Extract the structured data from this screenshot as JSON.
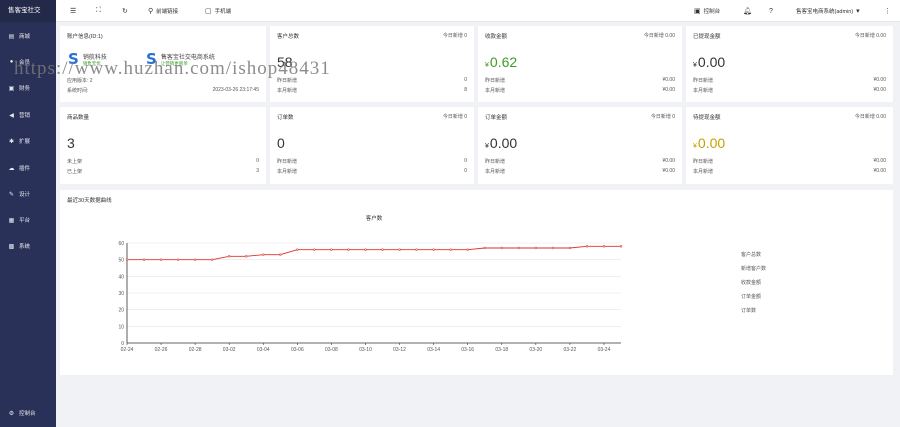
{
  "sidebar": {
    "brand": "售客宝社交",
    "items": [
      {
        "label": "商城",
        "icon": "shop-icon"
      },
      {
        "label": "会员",
        "icon": "member-icon"
      },
      {
        "label": "财务",
        "icon": "wallet-icon"
      },
      {
        "label": "营销",
        "icon": "megaphone-icon"
      },
      {
        "label": "扩展",
        "icon": "puzzle-icon"
      },
      {
        "label": "插件",
        "icon": "cloud-icon"
      },
      {
        "label": "设计",
        "icon": "design-icon"
      },
      {
        "label": "平台",
        "icon": "grid-icon"
      },
      {
        "label": "系统",
        "icon": "gear-icon"
      }
    ],
    "bottom": {
      "label": "控制台",
      "icon": "settings-icon"
    }
  },
  "topbar": {
    "menu_icon": "menu-icon",
    "fullscreen_icon": "fullscreen-icon",
    "refresh_icon": "refresh-icon",
    "link_label": "前端链接",
    "mobile_label": "手机端",
    "dashboard_label": "控制台",
    "user_label": "售客宝电商系统(admin)"
  },
  "cards": {
    "account": {
      "title": "账户信息(ID:1)",
      "logo1_title": "销航科技",
      "logo1_sub": "销售无忧",
      "logo2_title": "售客宝社交电商系统",
      "logo2_sub": "让营销更简单",
      "row1_label": "应用版本: 2",
      "row2_label": "系统时间:",
      "row2_value": "2023-03-26 23:17:45"
    },
    "customers": {
      "title": "客户总数",
      "today": "今日新增 0",
      "value": "58",
      "row1_label": "昨日新增",
      "row1_value": "0",
      "row2_label": "本月新增",
      "row2_value": "8"
    },
    "revenue": {
      "title": "收款金额",
      "today": "今日新增 0.00",
      "currency": "¥",
      "value": "0.62",
      "row1_label": "昨日新增",
      "row1_value": "¥0.00",
      "row2_label": "本月新增",
      "row2_value": "¥0.00"
    },
    "withdrawn": {
      "title": "已提现金额",
      "today": "今日新增 0.00",
      "currency": "¥",
      "value": "0.00",
      "row1_label": "昨日新增",
      "row1_value": "¥0.00",
      "row2_label": "本月新增",
      "row2_value": "¥0.00"
    },
    "products": {
      "title": "商品数量",
      "value": "3",
      "row1_label": "未上架",
      "row1_value": "0",
      "row2_label": "已上架",
      "row2_value": "3"
    },
    "orders": {
      "title": "订单数",
      "today": "今日新增 0",
      "value": "0",
      "row1_label": "昨日新增",
      "row1_value": "0",
      "row2_label": "本月新增",
      "row2_value": "0"
    },
    "order_amount": {
      "title": "订单金额",
      "today": "今日新增 0",
      "currency": "¥",
      "value": "0.00",
      "row1_label": "昨日新增",
      "row1_value": "¥0.00",
      "row2_label": "本月新增",
      "row2_value": "¥0.00"
    },
    "pending": {
      "title": "待提现金额",
      "today": "今日新增 0.00",
      "currency": "¥",
      "value": "0.00",
      "row1_label": "昨日新增",
      "row1_value": "¥0.00",
      "row2_label": "本月新增",
      "row2_value": "¥0.00"
    }
  },
  "chart_section": {
    "title": "最近30天数据曲线"
  },
  "watermark": "https://www.huzhan.com/ishop48431",
  "colors": {
    "sidebar": "#2a3158",
    "accent_green": "#3e9b28",
    "accent_gold": "#c7a000",
    "series_red": "#d9342b"
  },
  "chart_data": {
    "type": "line",
    "title": "客户数",
    "x": [
      "02-24",
      "02-25",
      "02-26",
      "02-27",
      "02-28",
      "03-01",
      "03-02",
      "03-03",
      "03-04",
      "03-05",
      "03-06",
      "03-07",
      "03-08",
      "03-09",
      "03-10",
      "03-11",
      "03-12",
      "03-13",
      "03-14",
      "03-15",
      "03-16",
      "03-17",
      "03-18",
      "03-19",
      "03-20",
      "03-21",
      "03-22",
      "03-23",
      "03-24",
      "03-25"
    ],
    "x_tick_labels": [
      "02-24",
      "02-26",
      "02-28",
      "03-02",
      "03-04",
      "03-06",
      "03-08",
      "03-10",
      "03-12",
      "03-14",
      "03-16",
      "03-18",
      "03-20",
      "03-22",
      "03-24"
    ],
    "series": [
      {
        "name": "客户总数",
        "color": "#d9342b",
        "values": [
          50,
          50,
          50,
          50,
          50,
          50,
          52,
          52,
          53,
          53,
          56,
          56,
          56,
          56,
          56,
          56,
          56,
          56,
          56,
          56,
          56,
          57,
          57,
          57,
          57,
          57,
          57,
          58,
          58,
          58
        ]
      }
    ],
    "legend": [
      "客户总数",
      "新增客户数",
      "收款金额",
      "订单金额",
      "订单数"
    ],
    "legend_position": "right",
    "ylim": [
      0,
      60
    ],
    "yticks": [
      0,
      10,
      20,
      30,
      40,
      50,
      60
    ],
    "grid": true
  }
}
